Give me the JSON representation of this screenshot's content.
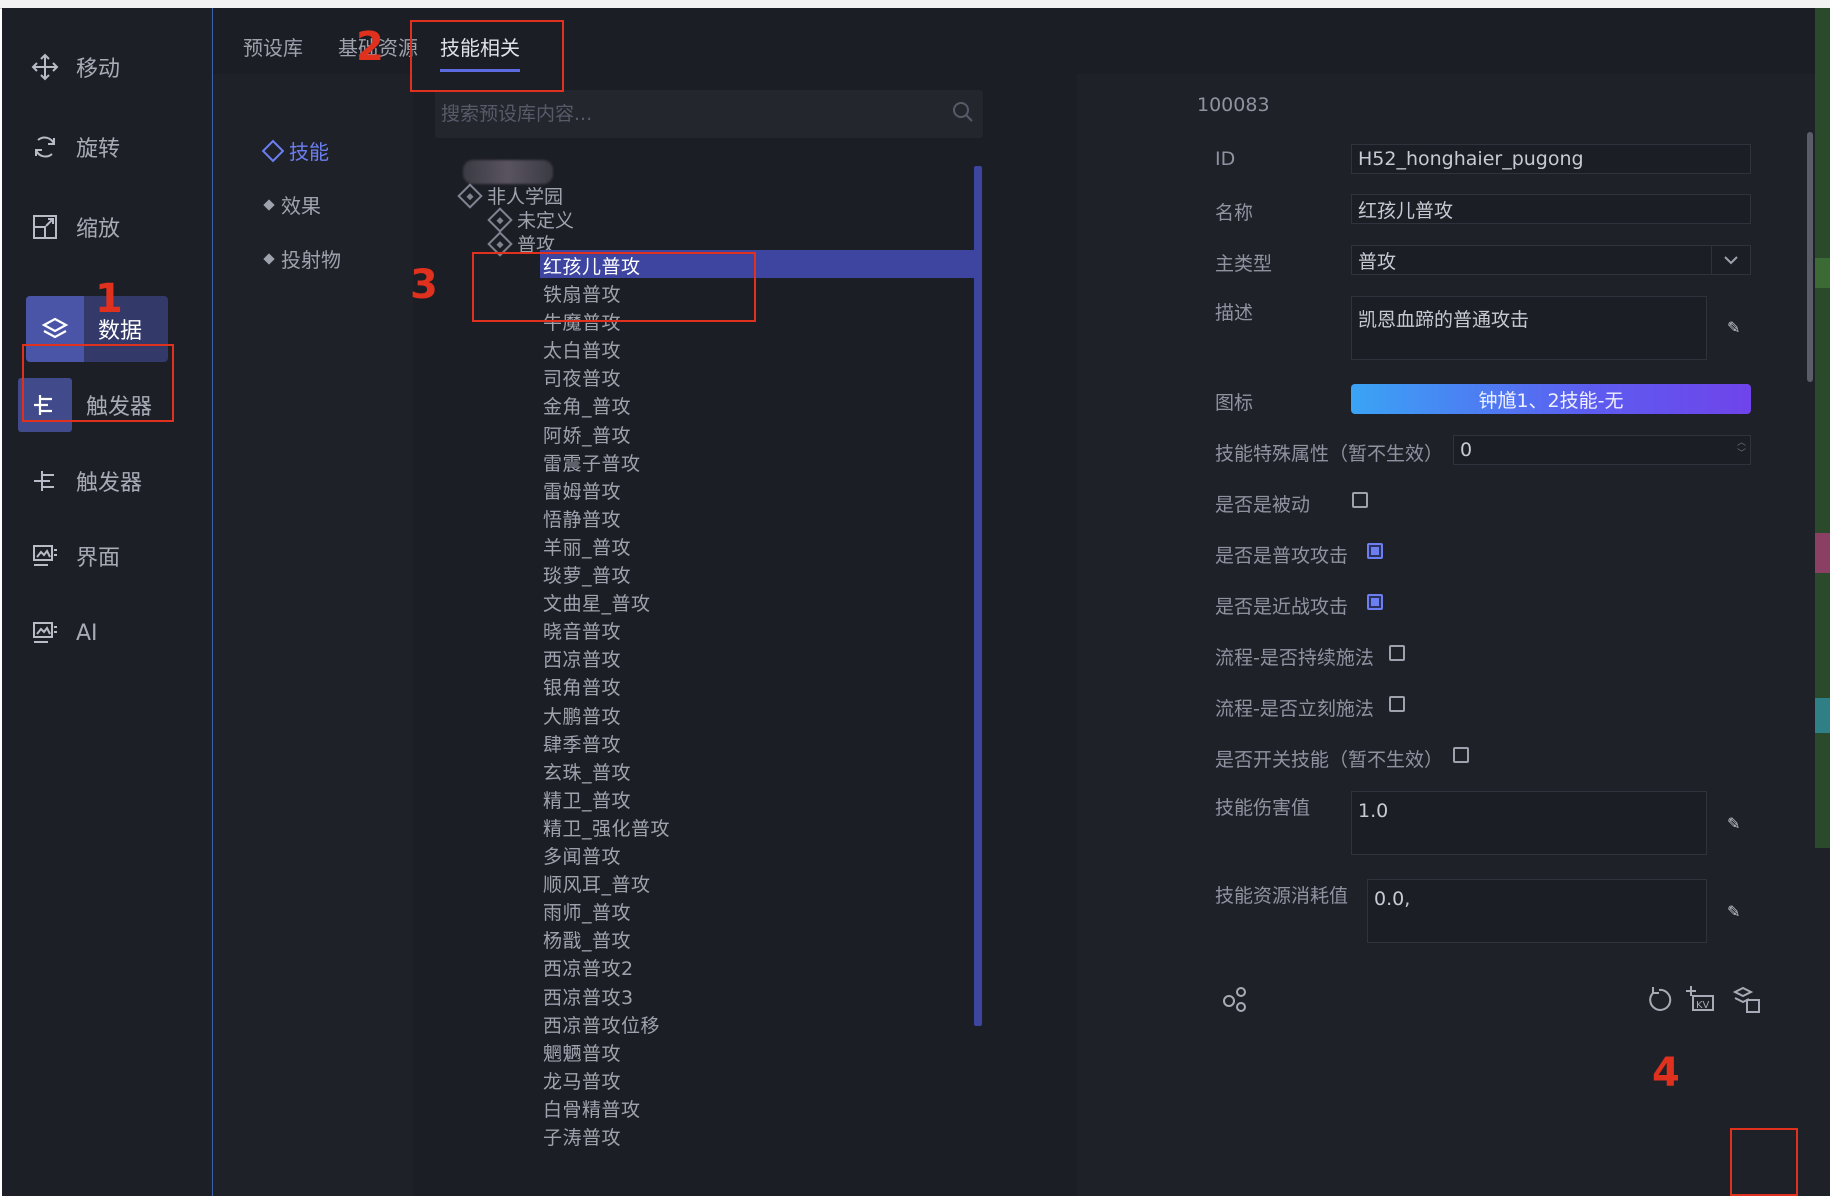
{
  "nav": {
    "items": [
      {
        "label": "移动",
        "icon": "move-icon"
      },
      {
        "label": "旋转",
        "icon": "rotate-icon"
      },
      {
        "label": "缩放",
        "icon": "scale-icon"
      },
      {
        "label": "数据",
        "icon": "data-layers-icon"
      },
      {
        "label": "触发器",
        "icon": "trigger-icon"
      },
      {
        "label": "触发器",
        "icon": "trigger-icon"
      },
      {
        "label": "界面",
        "icon": "ui-icon"
      },
      {
        "label": "AI",
        "icon": "ai-icon"
      }
    ],
    "active_index": 3
  },
  "tabs": [
    {
      "label": "预设库"
    },
    {
      "label": "基础资源"
    },
    {
      "label": "技能相关"
    }
  ],
  "categories": [
    {
      "label": "技能"
    },
    {
      "label": "效果"
    },
    {
      "label": "投射物"
    }
  ],
  "search": {
    "placeholder": "搜索预设库内容..."
  },
  "tree": {
    "root": "非人学园",
    "child1": "未定义",
    "child2": "普攻",
    "selected": "红孩儿普攻",
    "leaves": [
      "铁扇普攻",
      "牛魔普攻",
      "太白普攻",
      "司夜普攻",
      "金角_普攻",
      "阿娇_普攻",
      "雷震子普攻",
      "雷姆普攻",
      "悟静普攻",
      "羊丽_普攻",
      "琰萝_普攻",
      "文曲星_普攻",
      "晓音普攻",
      "西凉普攻",
      "银角普攻",
      "大鹏普攻",
      "肆季普攻",
      "玄珠_普攻",
      "精卫_普攻",
      "精卫_强化普攻",
      "多闻普攻",
      "顺风耳_普攻",
      "雨师_普攻",
      "杨戬_普攻",
      "西凉普攻2",
      "西凉普攻3",
      "西凉普攻位移",
      "魍魉普攻",
      "龙马普攻",
      "白骨精普攻",
      "子涛普攻"
    ]
  },
  "detail": {
    "header_id": "100083",
    "labels": {
      "id": "ID",
      "name": "名称",
      "main_type": "主类型",
      "desc": "描述",
      "icon": "图标",
      "special": "技能特殊属性（暂不生效）",
      "passive": "是否是被动",
      "normal_attack": "是否是普攻攻击",
      "melee": "是否是近战攻击",
      "continuous": "流程-是否持续施法",
      "instant": "流程-是否立刻施法",
      "toggle": "是否开关技能（暂不生效）",
      "damage": "技能伤害值",
      "cost": "技能资源消耗值"
    },
    "values": {
      "id": "H52_honghaier_pugong",
      "name": "红孩儿普攻",
      "main_type": "普攻",
      "desc": "凯恩血蹄的普通攻击",
      "icon_button": "钟馗1、2技能-无",
      "special": "0",
      "damage": "1.0",
      "cost": "0.0,"
    },
    "checks": {
      "passive": false,
      "normal_attack": true,
      "melee": true,
      "continuous": false,
      "instant": false,
      "toggle": false
    }
  },
  "annotations": [
    "1",
    "2",
    "3",
    "4"
  ],
  "colors": {
    "accent": "#5c6be0",
    "selection": "#3d45a0",
    "annotation": "#e0301e"
  }
}
